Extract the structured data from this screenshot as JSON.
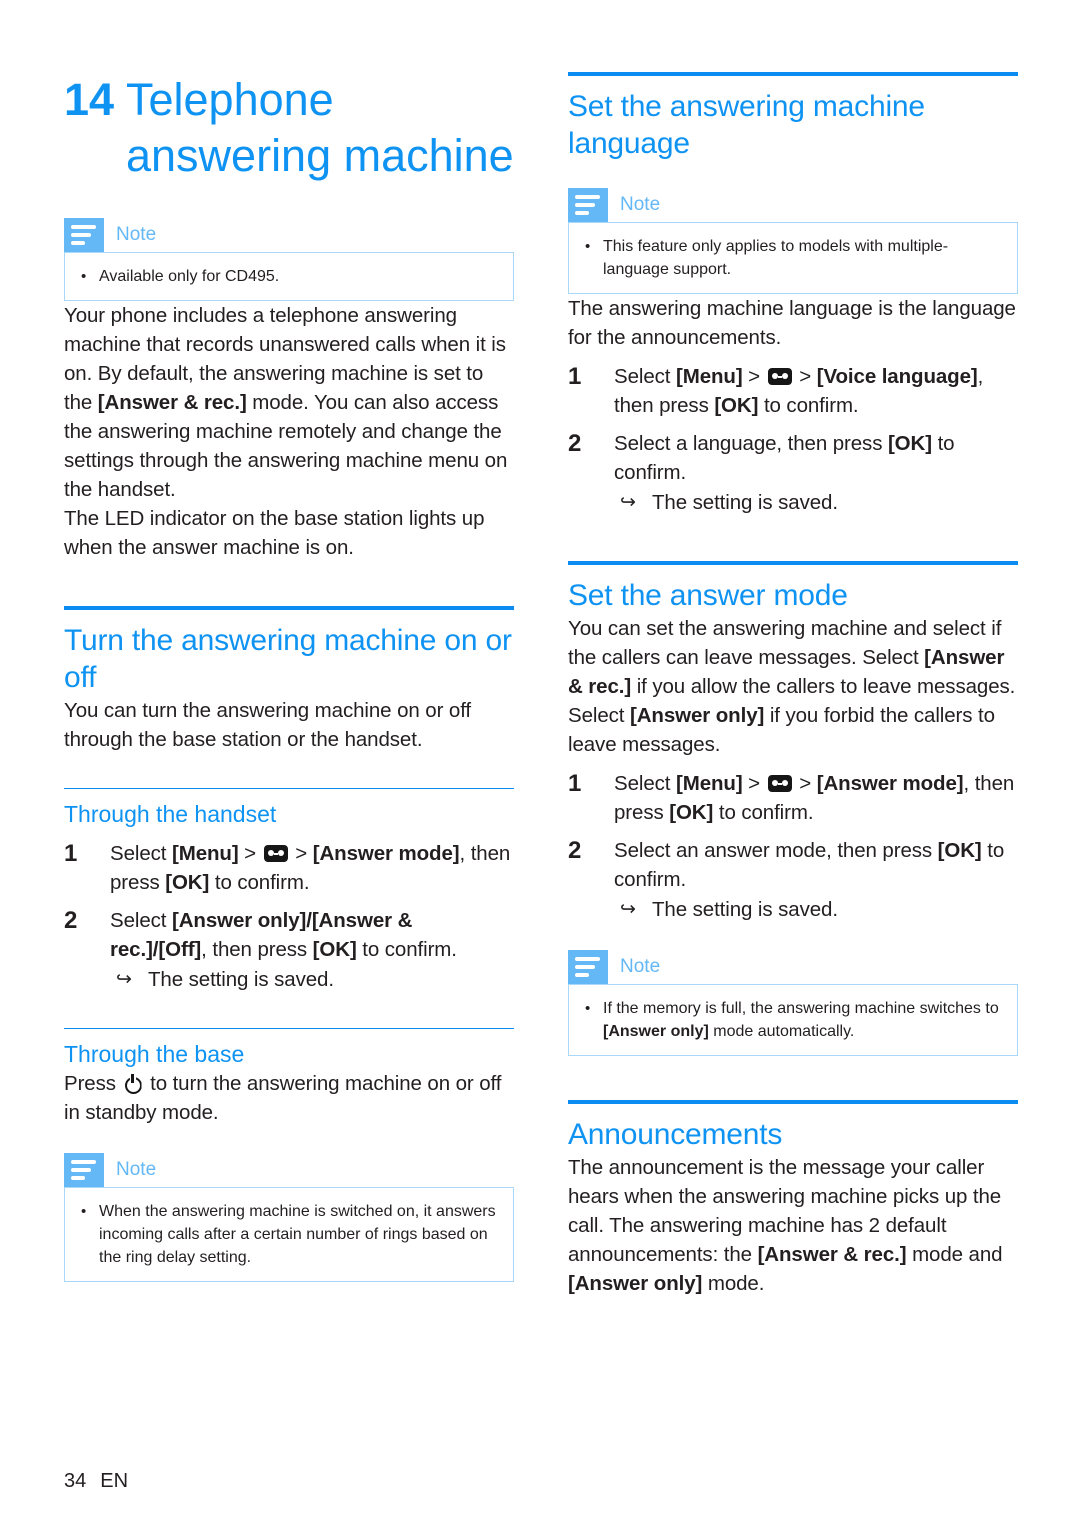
{
  "chapter": {
    "number": "14",
    "title": "Telephone answering machine"
  },
  "footer": {
    "page_number": "34",
    "language_code": "EN"
  },
  "note_label": "Note",
  "left_column": {
    "note_availability": "Available only for CD495.",
    "intro_paragraph_1_a": "Your phone includes a telephone answering machine that records unanswered calls when it is on. By default, the answering machine is set to the ",
    "intro_paragraph_1_b": "[Answer & rec.]",
    "intro_paragraph_1_c": " mode. You can also access the answering machine remotely and change the settings through the answering machine menu on the handset.",
    "intro_paragraph_2": "The LED indicator on the base station lights up when the answer machine is on.",
    "section_turn_onoff": {
      "heading": "Turn the answering machine on or off",
      "paragraph": "You can turn the answering machine on or off through the base station or the handset.",
      "sub_handset": {
        "heading": "Through the handset",
        "steps": [
          {
            "num": "1",
            "parts": [
              {
                "t": "Select ",
                "bold": false
              },
              {
                "t": "[Menu]",
                "bold": true
              },
              {
                "t": " > ",
                "bold": false
              },
              {
                "t": "ICON_TAPE",
                "bold": false
              },
              {
                "t": " > ",
                "bold": false
              },
              {
                "t": "[Answer mode]",
                "bold": true
              },
              {
                "t": ", then press ",
                "bold": false
              },
              {
                "t": "[OK]",
                "bold": true
              },
              {
                "t": " to confirm.",
                "bold": false
              }
            ]
          },
          {
            "num": "2",
            "parts": [
              {
                "t": "Select ",
                "bold": false
              },
              {
                "t": "[Answer only]/[Answer & rec.]/[Off]",
                "bold": true
              },
              {
                "t": ", then press ",
                "bold": false
              },
              {
                "t": "[OK]",
                "bold": true
              },
              {
                "t": " to confirm.",
                "bold": false
              }
            ],
            "substep": "The setting is saved."
          }
        ]
      },
      "sub_base": {
        "heading": "Through the base",
        "paragraph_a": "Press ",
        "paragraph_b": " to turn the answering machine on or off in standby mode.",
        "note": "When the answering machine is switched on, it answers incoming calls after a certain number of rings based on the ring delay setting."
      }
    }
  },
  "right_column": {
    "section_language": {
      "heading": "Set the answering machine language",
      "note": "This feature only applies to models with multiple-language support.",
      "paragraph": "The answering machine language is the language for the announcements.",
      "steps": [
        {
          "num": "1",
          "parts": [
            {
              "t": "Select ",
              "bold": false
            },
            {
              "t": "[Menu]",
              "bold": true
            },
            {
              "t": " > ",
              "bold": false
            },
            {
              "t": "ICON_TAPE",
              "bold": false
            },
            {
              "t": " > ",
              "bold": false
            },
            {
              "t": "[Voice language]",
              "bold": true
            },
            {
              "t": ", then press ",
              "bold": false
            },
            {
              "t": "[OK]",
              "bold": true
            },
            {
              "t": " to confirm.",
              "bold": false
            }
          ]
        },
        {
          "num": "2",
          "parts": [
            {
              "t": "Select a language, then press ",
              "bold": false
            },
            {
              "t": "[OK]",
              "bold": true
            },
            {
              "t": " to confirm.",
              "bold": false
            }
          ],
          "substep": "The setting is saved."
        }
      ]
    },
    "section_answer_mode": {
      "heading": "Set the answer mode",
      "paragraph_parts": [
        {
          "t": "You can set the answering machine and select if the callers can leave messages. Select ",
          "bold": false
        },
        {
          "t": "[Answer & rec.]",
          "bold": true
        },
        {
          "t": " if you allow the callers to leave messages. Select ",
          "bold": false
        },
        {
          "t": "[Answer only]",
          "bold": true
        },
        {
          "t": " if you forbid the callers to leave messages.",
          "bold": false
        }
      ],
      "steps": [
        {
          "num": "1",
          "parts": [
            {
              "t": "Select ",
              "bold": false
            },
            {
              "t": "[Menu]",
              "bold": true
            },
            {
              "t": " > ",
              "bold": false
            },
            {
              "t": "ICON_TAPE",
              "bold": false
            },
            {
              "t": " > ",
              "bold": false
            },
            {
              "t": "[Answer mode]",
              "bold": true
            },
            {
              "t": ", then press ",
              "bold": false
            },
            {
              "t": "[OK]",
              "bold": true
            },
            {
              "t": " to confirm.",
              "bold": false
            }
          ]
        },
        {
          "num": "2",
          "parts": [
            {
              "t": "Select an answer mode, then press ",
              "bold": false
            },
            {
              "t": "[OK]",
              "bold": true
            },
            {
              "t": " to confirm.",
              "bold": false
            }
          ],
          "substep": "The setting is saved."
        }
      ],
      "note_parts": [
        {
          "t": "If the memory is full, the answering machine switches to ",
          "bold": false
        },
        {
          "t": "[Answer only]",
          "bold": true
        },
        {
          "t": " mode automatically.",
          "bold": false
        }
      ]
    },
    "section_announcements": {
      "heading": "Announcements",
      "paragraph_parts": [
        {
          "t": "The announcement is the message your caller hears when the answering machine picks up the call. The answering machine has 2 default announcements: the ",
          "bold": false
        },
        {
          "t": "[Answer & rec.]",
          "bold": true
        },
        {
          "t": " mode and ",
          "bold": false
        },
        {
          "t": "[Answer only]",
          "bold": true
        },
        {
          "t": " mode.",
          "bold": false
        }
      ]
    }
  },
  "colors": {
    "heading_blue": "#0f93f2",
    "rule_blue": "#0b8cf0",
    "note_blue": "#63b8f5",
    "note_border": "#a8d8f7",
    "body_text": "#231f20"
  }
}
